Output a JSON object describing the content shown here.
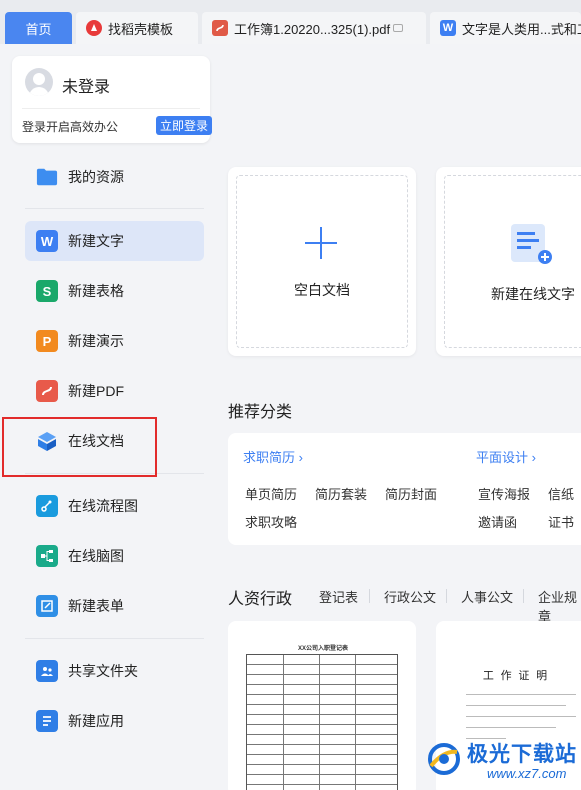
{
  "tabs": [
    {
      "label": "首页",
      "icon": "home"
    },
    {
      "label": "找稻壳模板",
      "icon": "docer-icon",
      "color": "#e83a3a"
    },
    {
      "label": "工作簿1.20220...325(1).pdf",
      "icon": "pdf-icon",
      "color": "#e05a47"
    },
    {
      "label": "文字是人类用...式和工作",
      "icon": "word-icon",
      "color": "#3d7ff2"
    }
  ],
  "login": {
    "title": "未登录",
    "tip": "登录开启高效办公",
    "button": "立即登录"
  },
  "sidebar": {
    "items": [
      {
        "label": "我的资源",
        "icon": "folder-icon",
        "color": "#3d8df0"
      },
      {
        "label": "新建文字",
        "icon": "word-icon",
        "color": "#3d7ff2",
        "glyph": "W"
      },
      {
        "label": "新建表格",
        "icon": "sheet-icon",
        "color": "#1aa86a",
        "glyph": "S"
      },
      {
        "label": "新建演示",
        "icon": "presentation-icon",
        "color": "#f28a1f",
        "glyph": "P"
      },
      {
        "label": "新建PDF",
        "icon": "pdf-icon",
        "color": "#e85a4a"
      },
      {
        "label": "在线文档",
        "icon": "cloud-doc-icon",
        "color": "#2f7ee6"
      },
      {
        "label": "在线流程图",
        "icon": "flowchart-icon",
        "color": "#1a9bde"
      },
      {
        "label": "在线脑图",
        "icon": "mindmap-icon",
        "color": "#1aaa8a"
      },
      {
        "label": "新建表单",
        "icon": "form-icon",
        "color": "#2f8fe6"
      },
      {
        "label": "共享文件夹",
        "icon": "shared-folder-icon",
        "color": "#2f7ee6"
      },
      {
        "label": "新建应用",
        "icon": "app-icon",
        "color": "#2f7ee6"
      }
    ]
  },
  "main": {
    "blank_doc": "空白文档",
    "online_text": "新建在线文字",
    "recommend_title": "推荐分类",
    "categories": [
      {
        "head": "求职简历",
        "items": [
          "单页简历",
          "简历套装",
          "简历封面",
          "求职攻略"
        ]
      },
      {
        "head": "平面设计",
        "items": [
          "宣传海报",
          "信纸",
          "邀请函",
          "证书"
        ]
      }
    ],
    "hr_title": "人资行政",
    "hr_tabs": [
      "登记表",
      "行政公文",
      "人事公文",
      "企业规章"
    ],
    "doc1_title": "XX公司入职登记表",
    "doc2_title": "工 作 证 明"
  },
  "watermark": {
    "name": "极光下载站",
    "url": "www.xz7.com"
  }
}
